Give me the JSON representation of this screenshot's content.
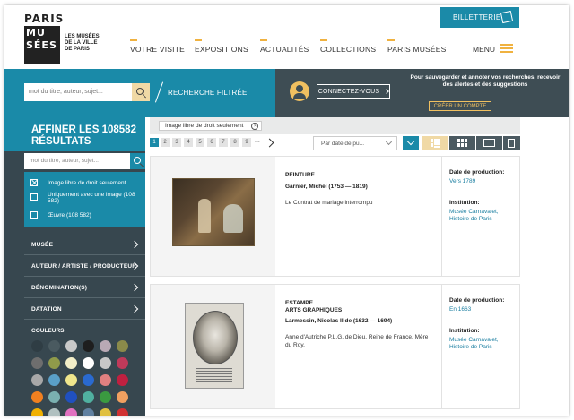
{
  "header": {
    "logo": {
      "line1": "PARIS",
      "block": "MU\nSÉES",
      "subtitle": "LES MUSÉES DE LA VILLE DE PARIS"
    },
    "nav": [
      "VOTRE VISITE",
      "EXPOSITIONS",
      "ACTUALITÉS",
      "COLLECTIONS",
      "PARIS MUSÉES"
    ],
    "menu_label": "MENU",
    "billetterie_label": "BILLETTERIE",
    "accent_color": "#f0b240",
    "brand_color": "#1a8aa8"
  },
  "searchbar": {
    "placeholder": "mot du titre, auteur, sujet...",
    "filtered_label": "RECHERCHE FILTRÉE",
    "connect_label": "CONNECTEZ-VOUS",
    "promo_text": "Pour sauvegarder et annoter vos recherches, recevoir des alertes et des suggestions",
    "create_account_label": "CRÉER UN COMPTE"
  },
  "sidebar": {
    "title": "AFFINER LES 108582 RÉSULTATS",
    "search_placeholder": "mot du titre, auteur, sujet...",
    "filters": [
      {
        "label": "Image libre de droit seulement",
        "checked": true
      },
      {
        "label": "Uniquement avec une image (108 582)",
        "checked": false
      },
      {
        "label": "Œuvre (108 582)",
        "checked": false
      }
    ],
    "facets": [
      "MUSÉE",
      "AUTEUR / ARTISTE / PRODUCTEUR",
      "DÉNOMINATION(S)",
      "DATATION"
    ],
    "colors_title": "COULEURS",
    "colors": [
      "#2f3d44",
      "#4a5a60",
      "#c9c9c9",
      "#1e1e1e",
      "#b9a9b5",
      "#8a8a4a",
      "#6e6e6e",
      "#8f9a4a",
      "#f2eec8",
      "#ffffff",
      "#c7c7c7",
      "#c03a5a",
      "#a8a8a8",
      "#5aa0c8",
      "#f0e68c",
      "#2a6ad0",
      "#e08080",
      "#c02040",
      "#f08020",
      "#7ab0b0",
      "#2050c0",
      "#50b0a0",
      "#3a9a40",
      "#f0a060",
      "#f0b000",
      "#b0c0c0",
      "#e070c0",
      "#6080a0",
      "#e0c040",
      "#d03030"
    ]
  },
  "results": {
    "active_tag": "Image libre de droit seulement",
    "pages": [
      "1",
      "2",
      "3",
      "4",
      "5",
      "6",
      "7",
      "8",
      "9"
    ],
    "current_page": "1",
    "ellipsis": "...",
    "sort_label": "Par date de pu...",
    "items": [
      {
        "type": "PEINTURE",
        "author": "Garnier, Michel (1753 — 1819)",
        "title": "Le Contrat de mariage interrompu",
        "date_label": "Date de production:",
        "date": "Vers 1789",
        "institution_label": "Institution:",
        "institution": "Musée Carnavalet, Histoire de Paris"
      },
      {
        "type": "ESTAMPE\nARTS GRAPHIQUES",
        "author": "Larmessin, Nicolas II de (1632 — 1694)",
        "title": "Anne d'Autriche P.L.G. de Dieu. Reine de France. Mère du Roy.",
        "date_label": "Date de production:",
        "date": "En 1663",
        "institution_label": "Institution:",
        "institution": "Musée Carnavalet, Histoire de Paris"
      }
    ]
  }
}
